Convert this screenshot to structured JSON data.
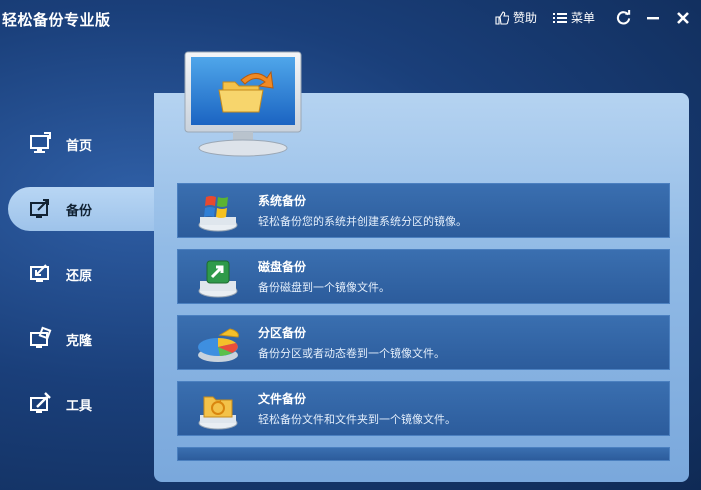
{
  "app": {
    "title": "轻松备份专业版"
  },
  "titlebar": {
    "donate_label": "赞助",
    "menu_label": "菜单"
  },
  "sidebar": {
    "items": [
      {
        "label": "首页",
        "icon": "home-monitor-icon",
        "active": false
      },
      {
        "label": "备份",
        "icon": "backup-export-icon",
        "active": true
      },
      {
        "label": "还原",
        "icon": "restore-icon",
        "active": false
      },
      {
        "label": "克隆",
        "icon": "clone-icon",
        "active": false
      },
      {
        "label": "工具",
        "icon": "tools-icon",
        "active": false
      }
    ]
  },
  "backup_options": [
    {
      "title": "系统备份",
      "desc": "轻松备份您的系统并创建系统分区的镜像。",
      "icon": "windows-system-icon"
    },
    {
      "title": "磁盘备份",
      "desc": "备份磁盘到一个镜像文件。",
      "icon": "disk-backup-icon"
    },
    {
      "title": "分区备份",
      "desc": "备份分区或者动态卷到一个镜像文件。",
      "icon": "partition-pie-icon"
    },
    {
      "title": "文件备份",
      "desc": "轻松备份文件和文件夹到一个镜像文件。",
      "icon": "file-folder-icon"
    }
  ],
  "colors": {
    "accent": "#2c5c9c",
    "panel": "#9ec3ea",
    "background": "#1a3f7a"
  }
}
